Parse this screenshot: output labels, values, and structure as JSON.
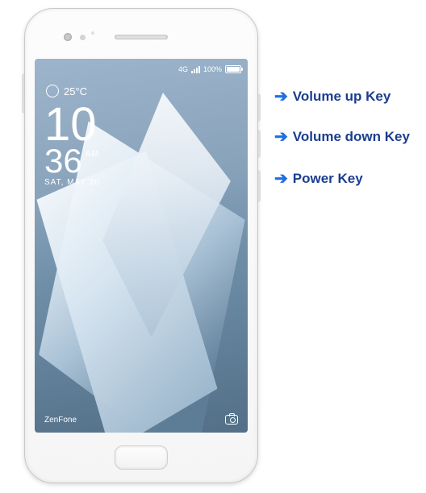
{
  "labels": {
    "volume_up": "Volume up Key",
    "volume_down": "Volume down Key",
    "power": "Power Key"
  },
  "phone": {
    "status": {
      "network_label": "4G",
      "battery_pct": "100%"
    },
    "weather": {
      "temp": "25°C"
    },
    "clock": {
      "hours": "10",
      "minutes": "36",
      "ampm": "AM",
      "date": "SAT, MAY 20"
    },
    "brand": "ZenFone"
  }
}
